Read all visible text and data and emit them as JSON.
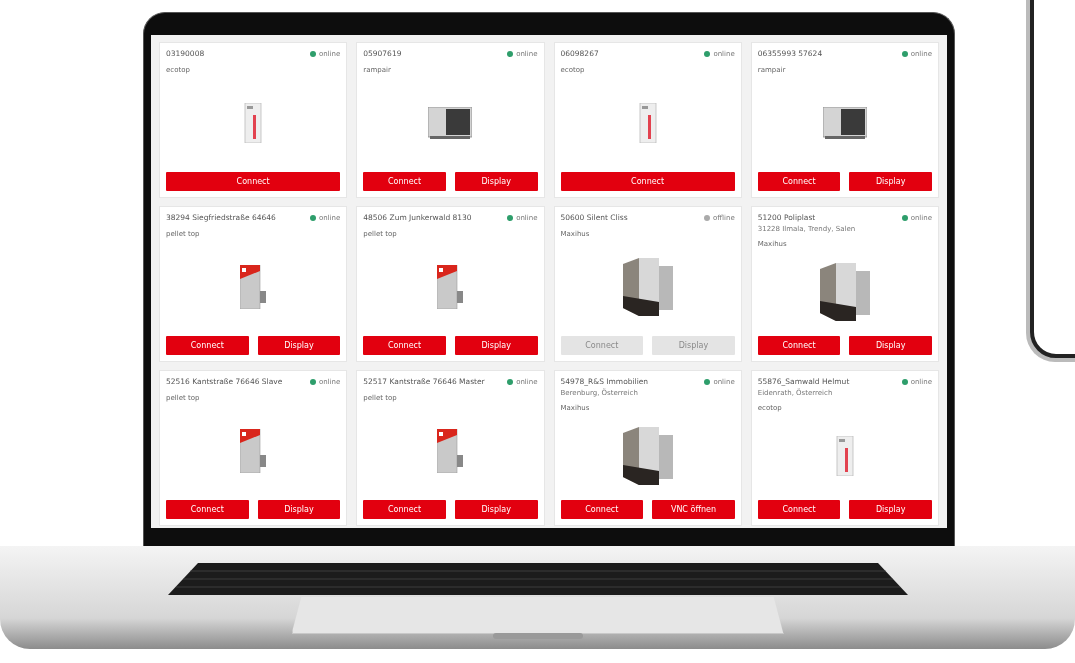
{
  "devices": [
    {
      "title": "03190008",
      "online": true,
      "status": "online",
      "type": "ecotop",
      "kind": "cabinet",
      "buttons": [
        {
          "label": "Connect",
          "disabled": false
        }
      ]
    },
    {
      "title": "05907619",
      "online": true,
      "status": "online",
      "type": "rampair",
      "kind": "heatpump",
      "buttons": [
        {
          "label": "Connect",
          "disabled": false
        },
        {
          "label": "Display",
          "disabled": false
        }
      ]
    },
    {
      "title": "06098267",
      "online": true,
      "status": "online",
      "type": "ecotop",
      "kind": "cabinet",
      "buttons": [
        {
          "label": "Connect",
          "disabled": false
        }
      ]
    },
    {
      "title": "06355993 57624",
      "online": true,
      "status": "online",
      "type": "rampair",
      "kind": "heatpump",
      "buttons": [
        {
          "label": "Connect",
          "disabled": false
        },
        {
          "label": "Display",
          "disabled": false
        }
      ]
    },
    {
      "title": "38294 Siegfriedstraße 64646",
      "online": true,
      "status": "online",
      "type": "pellet top",
      "kind": "pellet",
      "buttons": [
        {
          "label": "Connect",
          "disabled": false
        },
        {
          "label": "Display",
          "disabled": false
        }
      ]
    },
    {
      "title": "48506 Zum Junkerwald 8130",
      "online": true,
      "status": "online",
      "type": "pellet top",
      "kind": "pellet",
      "buttons": [
        {
          "label": "Connect",
          "disabled": false
        },
        {
          "label": "Display",
          "disabled": false
        }
      ]
    },
    {
      "title": "50600 Silent Cliss",
      "online": false,
      "status": "offline",
      "type": "Maxihus",
      "kind": "tower",
      "buttons": [
        {
          "label": "Connect",
          "disabled": true
        },
        {
          "label": "Display",
          "disabled": true
        }
      ]
    },
    {
      "title": "51200 Poliplast",
      "subtitle": "31228 Ilmala, Trendy, Salen",
      "online": true,
      "status": "online",
      "type": "Maxihus",
      "kind": "tower",
      "buttons": [
        {
          "label": "Connect",
          "disabled": false
        },
        {
          "label": "Display",
          "disabled": false
        }
      ]
    },
    {
      "title": "52516 Kantstraße 76646 Slave",
      "online": true,
      "status": "online",
      "type": "pellet top",
      "kind": "pellet",
      "buttons": [
        {
          "label": "Connect",
          "disabled": false
        },
        {
          "label": "Display",
          "disabled": false
        }
      ]
    },
    {
      "title": "52517 Kantstraße 76646 Master",
      "online": true,
      "status": "online",
      "type": "pellet top",
      "kind": "pellet",
      "buttons": [
        {
          "label": "Connect",
          "disabled": false
        },
        {
          "label": "Display",
          "disabled": false
        }
      ]
    },
    {
      "title": "54978_R&S Immobilien",
      "subtitle": "Berenburg, Österreich",
      "online": true,
      "status": "online",
      "type": "Maxihus",
      "kind": "tower",
      "buttons": [
        {
          "label": "Connect",
          "disabled": false
        },
        {
          "label": "VNC öffnen",
          "disabled": false
        }
      ]
    },
    {
      "title": "55876_Samwald Helmut",
      "subtitle": "Eidenrath, Österreich",
      "online": true,
      "status": "online",
      "type": "ecotop",
      "kind": "cabinet",
      "buttons": [
        {
          "label": "Connect",
          "disabled": false
        },
        {
          "label": "Display",
          "disabled": false
        }
      ]
    }
  ]
}
